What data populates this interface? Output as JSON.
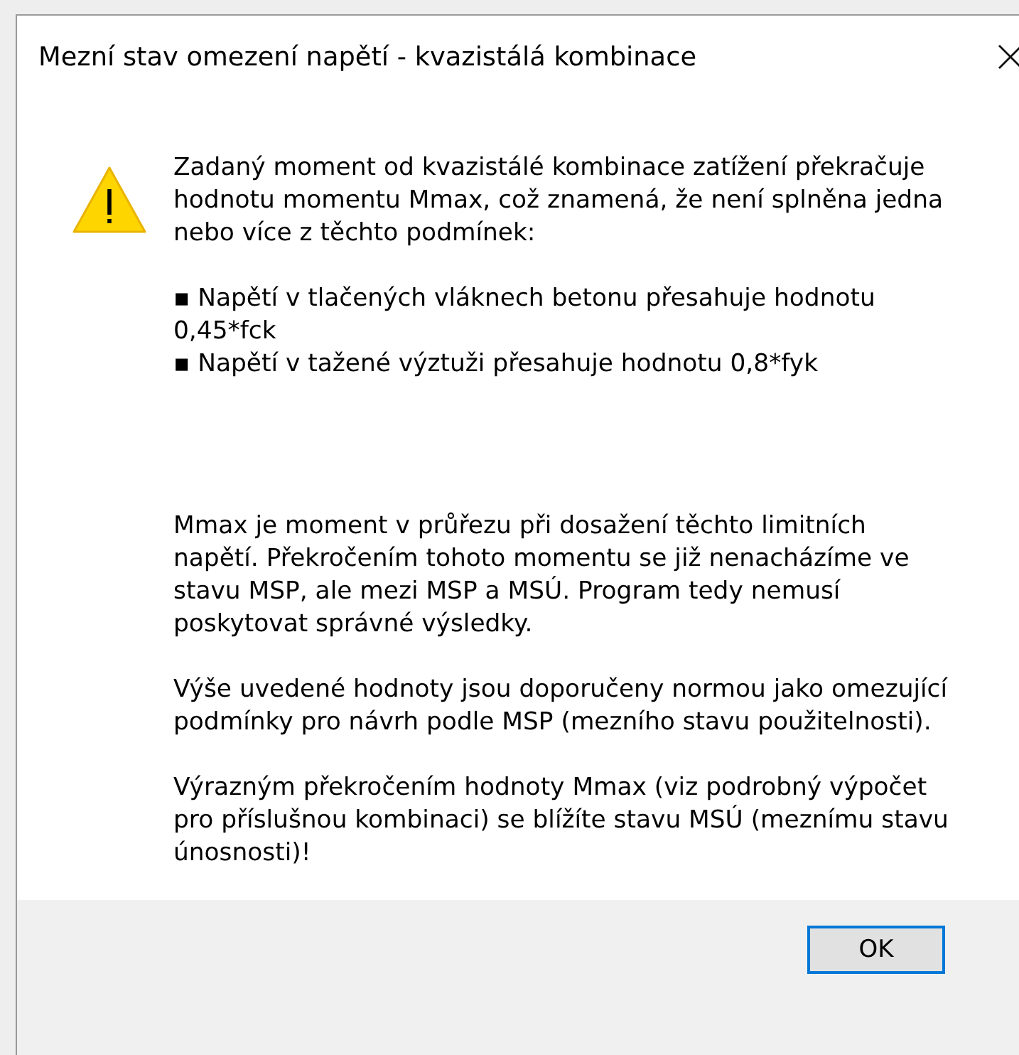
{
  "window": {
    "title": "Mezní stav omezení napětí - kvazistálá kombinace"
  },
  "message": {
    "intro": "Zadaný moment od kvazistálé kombinace zatížení překračuje hodnotu momentu Mmax, což znamená, že není splněna jedna nebo více z těchto podmínek:",
    "conditions": [
      "▪ Napětí v tlačených vláknech betonu přesahuje hodnotu 0,45*fck",
      "▪ Napětí v tažené výztuži přesahuje hodnotu 0,8*fyk"
    ],
    "paragraphs": [
      "Mmax je moment v průřezu při dosažení těchto limitních napětí. Překročením tohoto momentu se již nenacházíme ve stavu MSP, ale mezi MSP a MSÚ. Program tedy nemusí poskytovat správné výsledky.",
      "Výše uvedené hodnoty jsou doporučeny normou jako omezující podmínky pro návrh podle MSP (mezního stavu použitelnosti).",
      "Výrazným překročením hodnoty Mmax (viz podrobný výpočet pro příslušnou kombinaci) se blížíte stavu MSÚ (meznímu stavu únosnosti)!"
    ]
  },
  "buttons": [
    {
      "label": "OK",
      "default": true
    }
  ]
}
